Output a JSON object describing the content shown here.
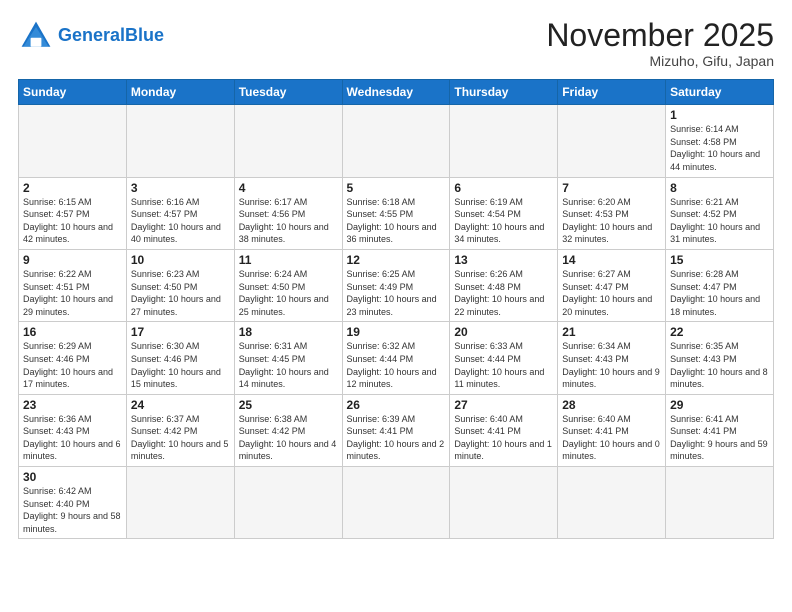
{
  "header": {
    "logo_general": "General",
    "logo_blue": "Blue",
    "month_title": "November 2025",
    "location": "Mizuho, Gifu, Japan"
  },
  "days_of_week": [
    "Sunday",
    "Monday",
    "Tuesday",
    "Wednesday",
    "Thursday",
    "Friday",
    "Saturday"
  ],
  "weeks": [
    [
      {
        "day": "",
        "info": ""
      },
      {
        "day": "",
        "info": ""
      },
      {
        "day": "",
        "info": ""
      },
      {
        "day": "",
        "info": ""
      },
      {
        "day": "",
        "info": ""
      },
      {
        "day": "",
        "info": ""
      },
      {
        "day": "1",
        "info": "Sunrise: 6:14 AM\nSunset: 4:58 PM\nDaylight: 10 hours and 44 minutes."
      }
    ],
    [
      {
        "day": "2",
        "info": "Sunrise: 6:15 AM\nSunset: 4:57 PM\nDaylight: 10 hours and 42 minutes."
      },
      {
        "day": "3",
        "info": "Sunrise: 6:16 AM\nSunset: 4:57 PM\nDaylight: 10 hours and 40 minutes."
      },
      {
        "day": "4",
        "info": "Sunrise: 6:17 AM\nSunset: 4:56 PM\nDaylight: 10 hours and 38 minutes."
      },
      {
        "day": "5",
        "info": "Sunrise: 6:18 AM\nSunset: 4:55 PM\nDaylight: 10 hours and 36 minutes."
      },
      {
        "day": "6",
        "info": "Sunrise: 6:19 AM\nSunset: 4:54 PM\nDaylight: 10 hours and 34 minutes."
      },
      {
        "day": "7",
        "info": "Sunrise: 6:20 AM\nSunset: 4:53 PM\nDaylight: 10 hours and 32 minutes."
      },
      {
        "day": "8",
        "info": "Sunrise: 6:21 AM\nSunset: 4:52 PM\nDaylight: 10 hours and 31 minutes."
      }
    ],
    [
      {
        "day": "9",
        "info": "Sunrise: 6:22 AM\nSunset: 4:51 PM\nDaylight: 10 hours and 29 minutes."
      },
      {
        "day": "10",
        "info": "Sunrise: 6:23 AM\nSunset: 4:50 PM\nDaylight: 10 hours and 27 minutes."
      },
      {
        "day": "11",
        "info": "Sunrise: 6:24 AM\nSunset: 4:50 PM\nDaylight: 10 hours and 25 minutes."
      },
      {
        "day": "12",
        "info": "Sunrise: 6:25 AM\nSunset: 4:49 PM\nDaylight: 10 hours and 23 minutes."
      },
      {
        "day": "13",
        "info": "Sunrise: 6:26 AM\nSunset: 4:48 PM\nDaylight: 10 hours and 22 minutes."
      },
      {
        "day": "14",
        "info": "Sunrise: 6:27 AM\nSunset: 4:47 PM\nDaylight: 10 hours and 20 minutes."
      },
      {
        "day": "15",
        "info": "Sunrise: 6:28 AM\nSunset: 4:47 PM\nDaylight: 10 hours and 18 minutes."
      }
    ],
    [
      {
        "day": "16",
        "info": "Sunrise: 6:29 AM\nSunset: 4:46 PM\nDaylight: 10 hours and 17 minutes."
      },
      {
        "day": "17",
        "info": "Sunrise: 6:30 AM\nSunset: 4:46 PM\nDaylight: 10 hours and 15 minutes."
      },
      {
        "day": "18",
        "info": "Sunrise: 6:31 AM\nSunset: 4:45 PM\nDaylight: 10 hours and 14 minutes."
      },
      {
        "day": "19",
        "info": "Sunrise: 6:32 AM\nSunset: 4:44 PM\nDaylight: 10 hours and 12 minutes."
      },
      {
        "day": "20",
        "info": "Sunrise: 6:33 AM\nSunset: 4:44 PM\nDaylight: 10 hours and 11 minutes."
      },
      {
        "day": "21",
        "info": "Sunrise: 6:34 AM\nSunset: 4:43 PM\nDaylight: 10 hours and 9 minutes."
      },
      {
        "day": "22",
        "info": "Sunrise: 6:35 AM\nSunset: 4:43 PM\nDaylight: 10 hours and 8 minutes."
      }
    ],
    [
      {
        "day": "23",
        "info": "Sunrise: 6:36 AM\nSunset: 4:43 PM\nDaylight: 10 hours and 6 minutes."
      },
      {
        "day": "24",
        "info": "Sunrise: 6:37 AM\nSunset: 4:42 PM\nDaylight: 10 hours and 5 minutes."
      },
      {
        "day": "25",
        "info": "Sunrise: 6:38 AM\nSunset: 4:42 PM\nDaylight: 10 hours and 4 minutes."
      },
      {
        "day": "26",
        "info": "Sunrise: 6:39 AM\nSunset: 4:41 PM\nDaylight: 10 hours and 2 minutes."
      },
      {
        "day": "27",
        "info": "Sunrise: 6:40 AM\nSunset: 4:41 PM\nDaylight: 10 hours and 1 minute."
      },
      {
        "day": "28",
        "info": "Sunrise: 6:40 AM\nSunset: 4:41 PM\nDaylight: 10 hours and 0 minutes."
      },
      {
        "day": "29",
        "info": "Sunrise: 6:41 AM\nSunset: 4:41 PM\nDaylight: 9 hours and 59 minutes."
      }
    ],
    [
      {
        "day": "30",
        "info": "Sunrise: 6:42 AM\nSunset: 4:40 PM\nDaylight: 9 hours and 58 minutes."
      },
      {
        "day": "",
        "info": ""
      },
      {
        "day": "",
        "info": ""
      },
      {
        "day": "",
        "info": ""
      },
      {
        "day": "",
        "info": ""
      },
      {
        "day": "",
        "info": ""
      },
      {
        "day": "",
        "info": ""
      }
    ]
  ]
}
